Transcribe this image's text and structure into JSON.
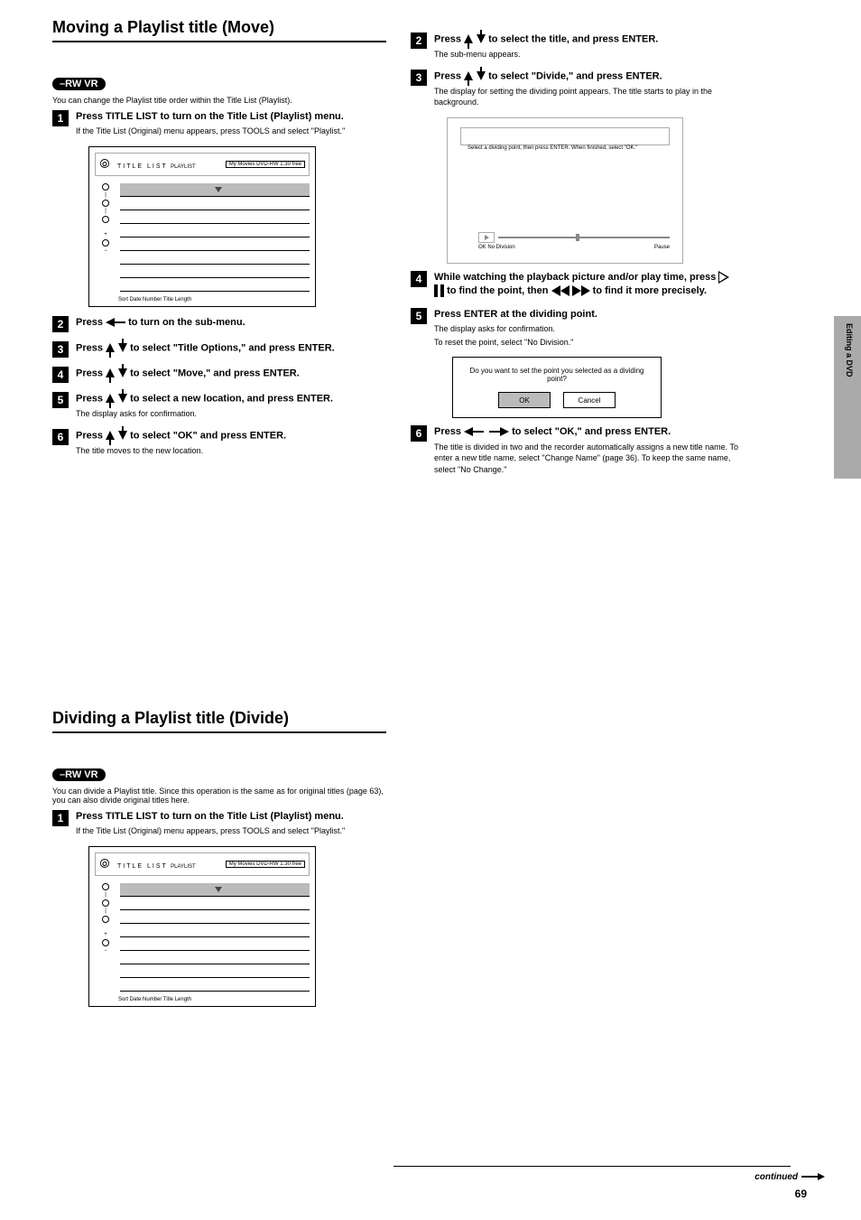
{
  "section1": {
    "title": "Moving a Playlist title (Move)",
    "badge": "–RW VR",
    "intro": "You can change the Playlist title order within the Title List (Playlist).",
    "step1": "Press TITLE LIST to turn on the Title List (Playlist) menu.",
    "step1_sub": "If the Title List (Original) menu appears, press TOOLS and select \"Playlist.\"",
    "tm_brand": "TITLE LIST",
    "tm_sub": "PLAYLIST",
    "tm_rw": "My Movies DVD-RW 1:30 free",
    "tm_foot": "Sort      Date       Number       Title       Length",
    "step2a": "Press ",
    "step2b": " to turn on the sub-menu.",
    "step3a": "Press ",
    "step3b": " to select \"Title Options,\" and press ENTER.",
    "step4a": "Press ",
    "step4b": " to select \"Move,\" and press ENTER.",
    "step5a": "Press ",
    "step5b": " to select a new location, and press ENTER.",
    "step5_sub": "The display asks for confirmation.",
    "step6a": "Press ",
    "step6b": " to select \"OK\" and press ENTER.",
    "step6_sub": "The title moves to the new location."
  },
  "section2": {
    "title": "Dividing a Playlist title (Divide)",
    "badge": "–RW VR",
    "intro": "You can divide a Playlist title. Since this operation is the same as for original titles (page 63), you can also divide original titles here.",
    "step1": "Press TITLE LIST to turn on the Title List (Playlist) menu.",
    "step1_sub": "If the Title List (Original) menu appears, press TOOLS and select \"Playlist.\"",
    "tm_brand": "TITLE LIST",
    "tm_sub": "PLAYLIST",
    "tm_rw": "My Movies DVD-RW 1:30 free",
    "tm_foot": "Sort      Date       Number       Title       Length"
  },
  "right": {
    "step2a": "Press ",
    "step2b": " to select the title, and press ENTER.",
    "step2_sub": "The sub-menu appears.",
    "step3a": "Press ",
    "step3b": " to select \"Divide,\" and press ENTER.",
    "step3_sub": "The display for setting the dividing point appears. The title starts to play in the background.",
    "mon_top": "Select a dividing point, then press ENTER. When finished, select \"OK.\"",
    "mon_bot_left": "OK  No Division",
    "mon_bot_right": "Pause",
    "step4a": "While watching the playback picture and/or play time, press ",
    "step4b": " to find the point, then ",
    "step4c": " to find it more precisely.",
    "step5": "Press ENTER at the dividing point.",
    "step5_sub": "The display asks for confirmation.",
    "step5_sub2": "To reset the point, select \"No Division.\"",
    "prompt_msg": "Do you want to set the point you selected as a dividing point?",
    "prompt_ok": "OK",
    "prompt_cancel": "Cancel",
    "step6a": "Press ",
    "step6b": " to select \"OK,\" and press ENTER.",
    "step6_sub": "The title is divided in two and the recorder automatically assigns a new title name. To enter a new title name, select \"Change Name\" (page 36). To keep the same name, select \"No Change.\""
  },
  "footer": {
    "side": "Editing a DVD",
    "page": "69",
    "cont": "continued"
  }
}
